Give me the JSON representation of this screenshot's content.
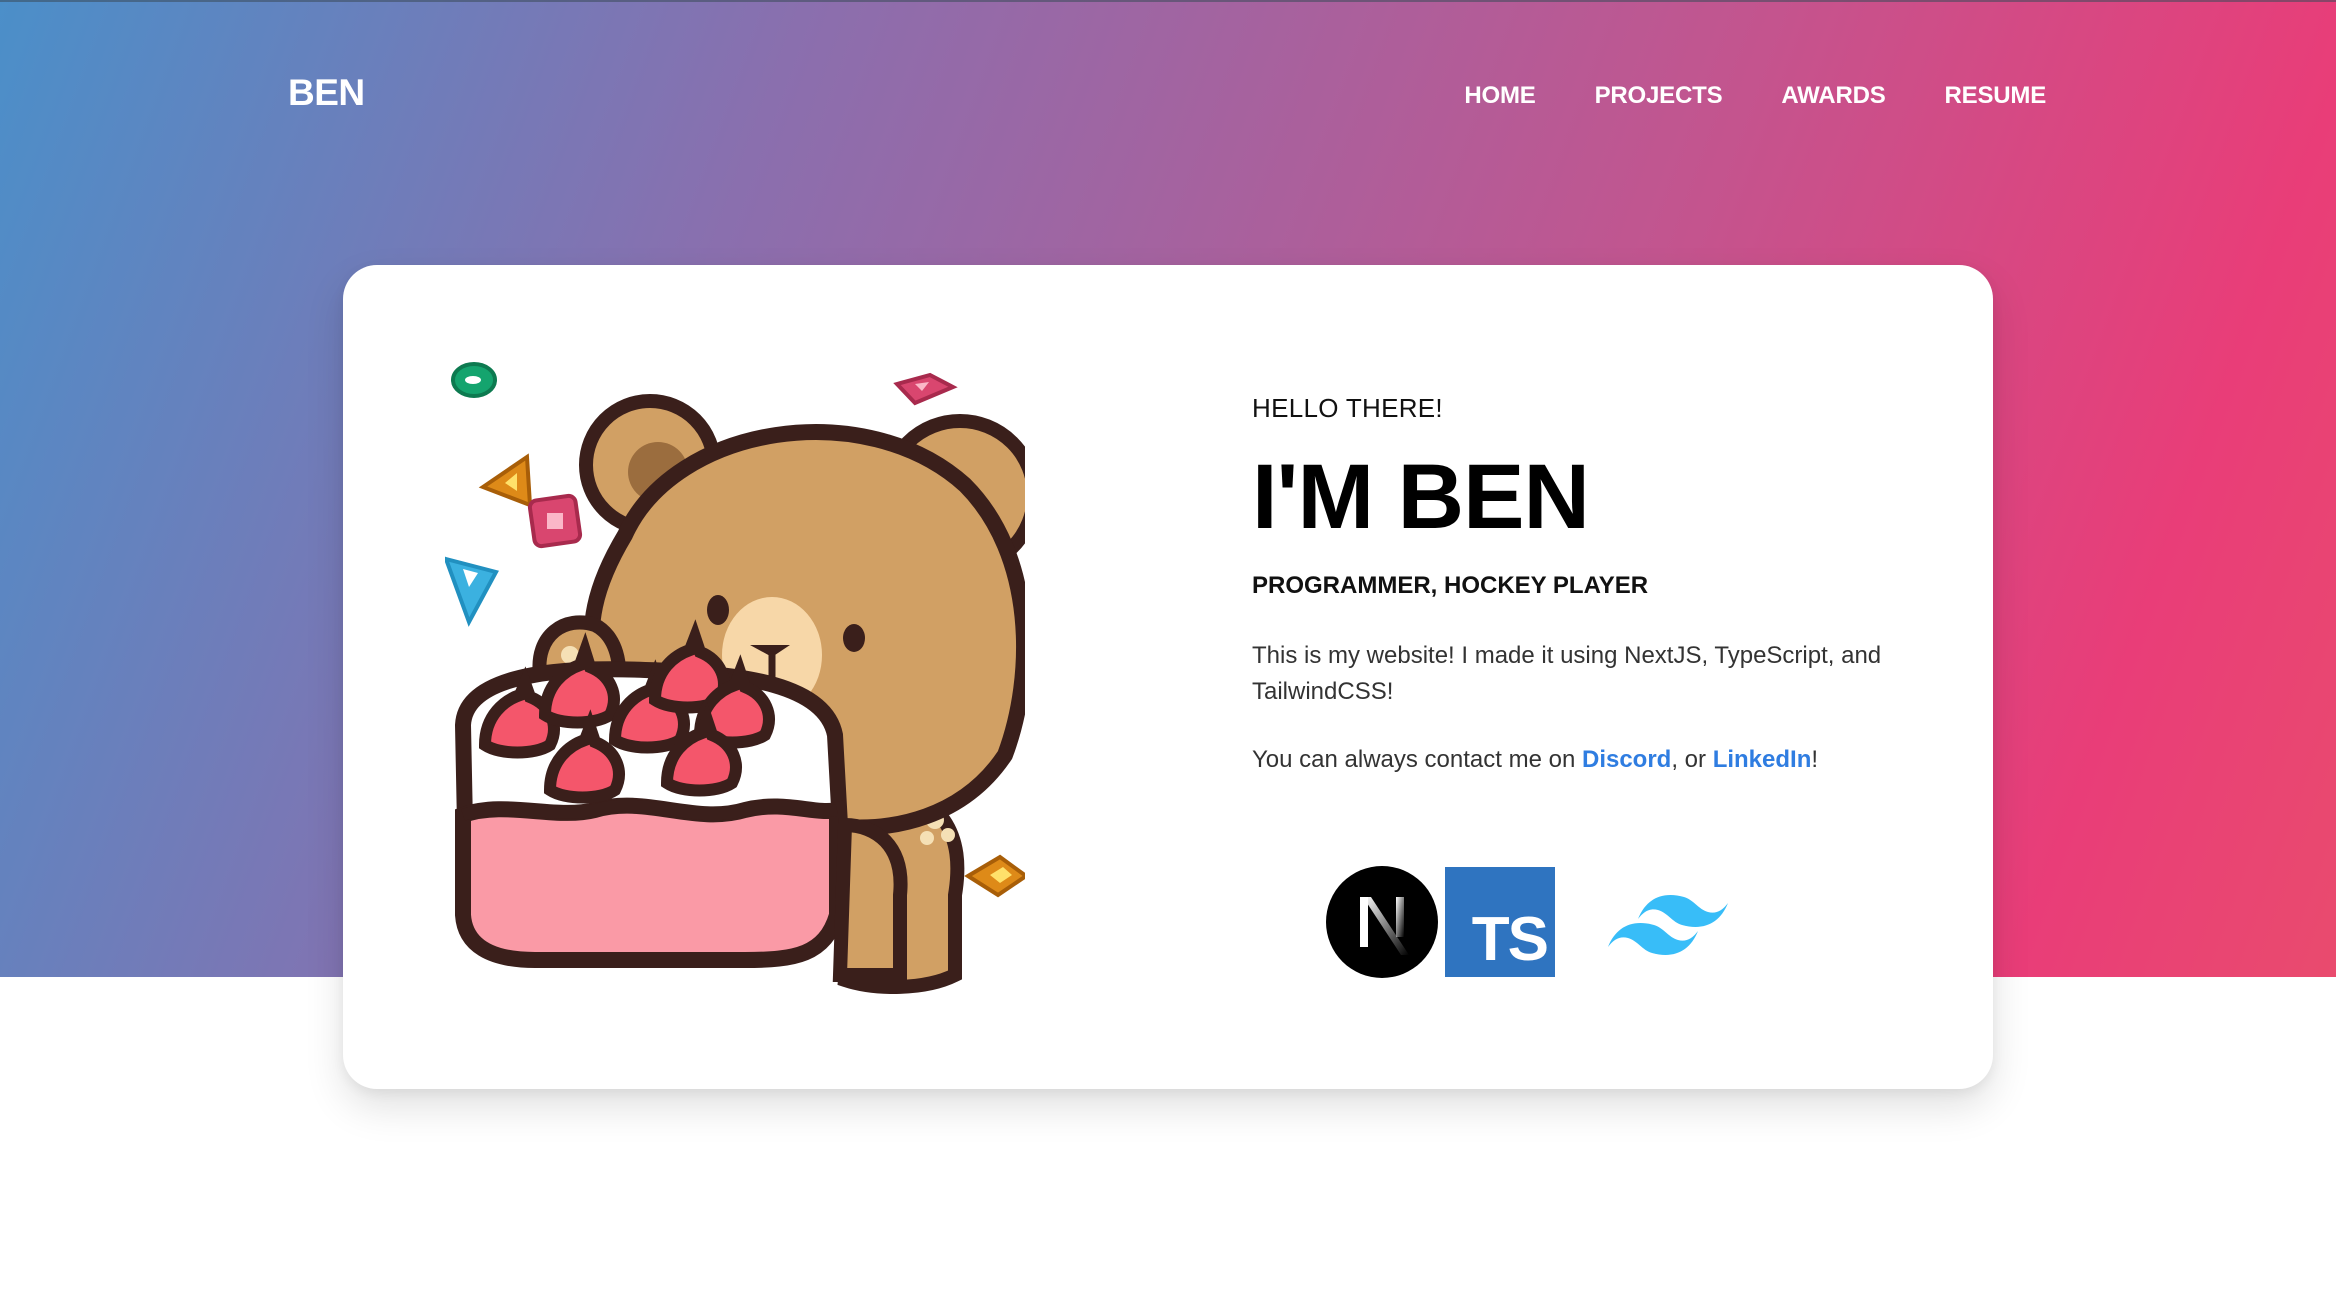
{
  "header": {
    "brand": "BEN",
    "nav": [
      "HOME",
      "PROJECTS",
      "AWARDS",
      "RESUME"
    ]
  },
  "hero": {
    "greeting": "HELLO THERE!",
    "title": "I'M BEN",
    "subtitle": "PROGRAMMER, HOCKEY PLAYER",
    "description": "This is my website! I made it using NextJS, TypeScript, and TailwindCSS!",
    "contact": {
      "prefix": "You can always contact me on ",
      "discord": "Discord",
      "separator": ", or ",
      "linkedin": "LinkedIn",
      "suffix": "!"
    },
    "tech_icons": [
      "nextjs-icon",
      "typescript-icon",
      "tailwindcss-icon"
    ],
    "typescript_badge": "TS"
  },
  "illustration": "bear-with-cake-icon",
  "colors": {
    "gradient_start": "#4b8fc9",
    "gradient_mid": "#c2558f",
    "gradient_end": "#e93d78",
    "link": "#2f7de1",
    "ts_blue": "#2f74c0",
    "tailwind_cyan": "#38bdf8"
  }
}
